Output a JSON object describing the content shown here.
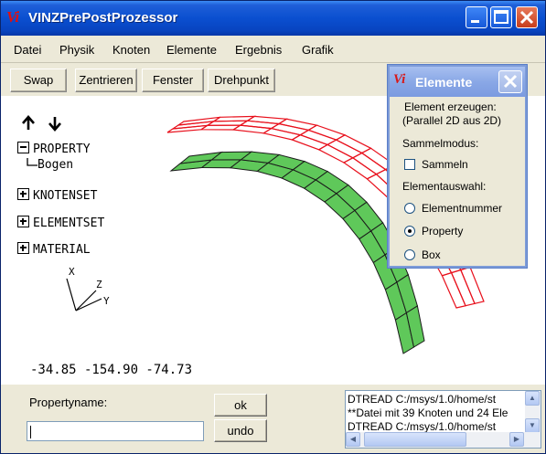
{
  "window": {
    "title": "VINZPrePostProzessor",
    "logo": "Vi"
  },
  "menu": [
    "Datei",
    "Physik",
    "Knoten",
    "Elemente",
    "Ergebnis",
    "Grafik"
  ],
  "toolbar": [
    "Swap",
    "Zentrieren",
    "Fenster",
    "Drehpunkt"
  ],
  "tree": {
    "property": "PROPERTY",
    "property_child": "Bogen",
    "knotenset": "KNOTENSET",
    "elementset": "ELEMENTSET",
    "material": "MATERIAL"
  },
  "axes": {
    "x": "X",
    "y": "Y",
    "z": "Z"
  },
  "coords": "-34.85 -154.90 -74.73",
  "bottom": {
    "property_label": "Propertyname:",
    "property_value": "",
    "ok_label": "ok",
    "undo_label": "undo"
  },
  "log": [
    "DTREAD C:/msys/1.0/home/st",
    "**Datei mit 39 Knoten und 24 Ele",
    "DTREAD C:/msys/1.0/home/st"
  ],
  "dialog": {
    "title": "Elemente",
    "line1": "Element erzeugen:",
    "line2": "(Parallel 2D aus 2D)",
    "sammelmodus": "Sammelmodus:",
    "sammeln": "Sammeln",
    "auswahl": "Elementauswahl:",
    "options": [
      "Elementnummer",
      "Property",
      "Box"
    ],
    "selected": "Property"
  },
  "colors": {
    "mesh_red": "#e8101c",
    "mesh_green": "#5fc85a",
    "title_blue": "#0a4fd0"
  }
}
